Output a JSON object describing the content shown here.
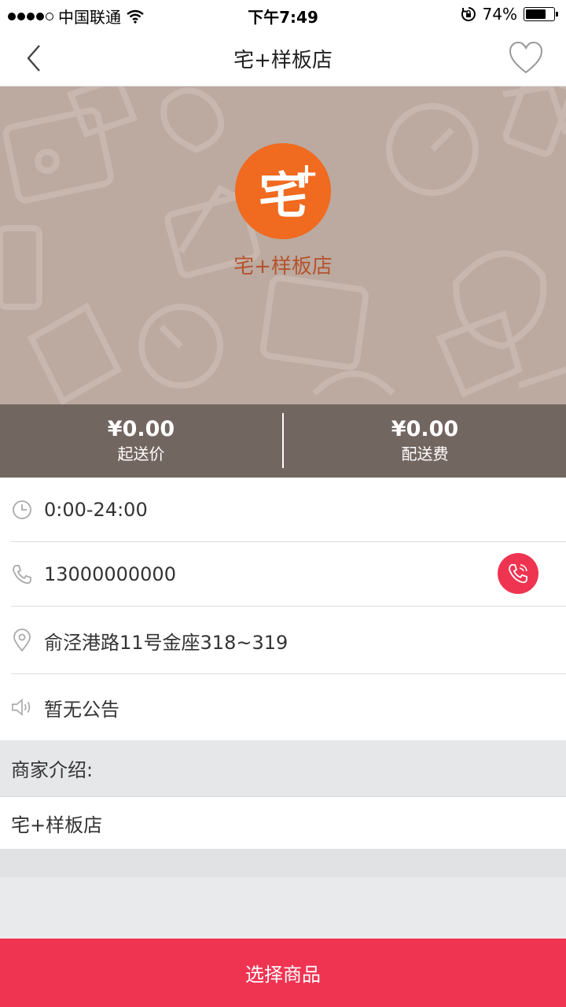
{
  "status_bar": {
    "carrier": "中国联通",
    "time": "下午7:49",
    "battery_percent": "74%",
    "battery_level": 0.74
  },
  "nav": {
    "title": "宅+样板店"
  },
  "store": {
    "logo_char": "宅",
    "logo_plus": "+",
    "name": "宅+样板店",
    "min_order_amount": "¥0.00",
    "min_order_label": "起送价",
    "delivery_fee_amount": "¥0.00",
    "delivery_fee_label": "配送费"
  },
  "info": {
    "hours": "0:00-24:00",
    "phone": "13000000000",
    "address": "俞泾港路11号金座318~319",
    "notice": "暂无公告"
  },
  "intro": {
    "heading": "商家介绍:",
    "body": "宅+样板店"
  },
  "cta": {
    "label": "选择商品"
  },
  "colors": {
    "accent": "#ef3452",
    "logo_bg": "#f06a1f",
    "hero_bg": "#bca99f"
  },
  "icons": [
    "back-arrow-icon",
    "heart-icon",
    "clock-icon",
    "phone-icon",
    "location-pin-icon",
    "speaker-icon",
    "phone-call-icon",
    "wifi-icon",
    "lock-rotation-icon"
  ]
}
